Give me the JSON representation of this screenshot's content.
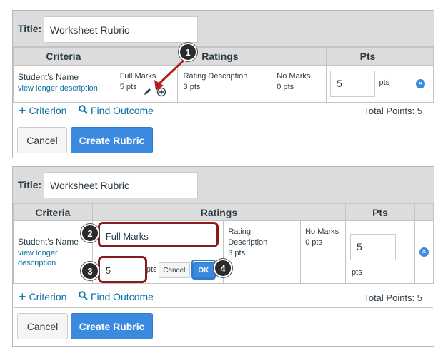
{
  "panel1": {
    "title_label": "Title:",
    "title_value": "Worksheet Rubric",
    "headers": {
      "criteria": "Criteria",
      "ratings": "Ratings",
      "pts": "Pts"
    },
    "criterion_name": "Student's Name",
    "criterion_link": "view longer description",
    "ratings": [
      {
        "label": "Full Marks",
        "pts": "5 pts"
      },
      {
        "label": "Rating Description",
        "pts": "3 pts"
      },
      {
        "label": "No Marks",
        "pts": "0 pts"
      }
    ],
    "points_value": "5",
    "points_unit": "pts",
    "add_criterion": "Criterion",
    "find_outcome": "Find Outcome",
    "total_points": "Total Points: 5",
    "cancel": "Cancel",
    "create": "Create Rubric"
  },
  "panel2": {
    "title_label": "Title:",
    "title_value": "Worksheet Rubric",
    "headers": {
      "criteria": "Criteria",
      "ratings": "Ratings",
      "pts": "Pts"
    },
    "criterion_name": "Student's Name",
    "criterion_link_1": "view longer",
    "criterion_link_2": "description",
    "edit_label_value": "Full Marks",
    "edit_points_value": "5",
    "edit_points_unit": "pts",
    "edit_cancel": "Cancel",
    "edit_ok": "OK",
    "ratings": [
      {
        "label_1": "Rating",
        "label_2": "Description",
        "pts": "3 pts"
      },
      {
        "label_1": "No Marks",
        "pts": "0 pts"
      }
    ],
    "points_value": "5",
    "points_unit": "pts",
    "add_criterion": "Criterion",
    "find_outcome": "Find Outcome",
    "total_points": "Total Points: 5",
    "cancel": "Cancel",
    "create": "Create Rubric"
  },
  "callouts": [
    "1",
    "2",
    "3",
    "4"
  ],
  "icons": {
    "plus": "plus-icon",
    "search": "search-icon",
    "pencil": "pencil-icon",
    "add_rating": "add-circle-icon",
    "remove": "remove-x-icon"
  },
  "colors": {
    "accent": "#3a8ae0",
    "link": "#0770a3",
    "highlight": "#8b1a1a",
    "header_bg": "#dcdcdc"
  }
}
